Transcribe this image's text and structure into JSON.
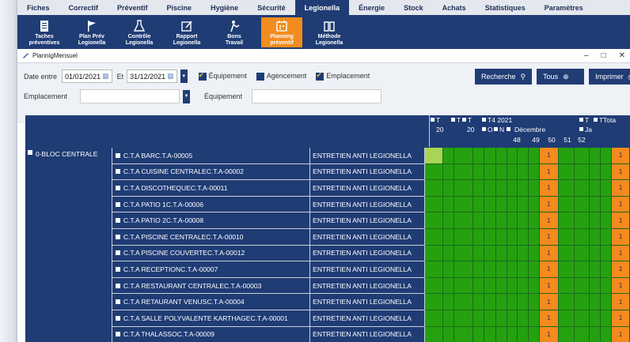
{
  "menu": [
    "Fiches",
    "Correctif",
    "Préventif",
    "Piscine",
    "Hygiène",
    "Sécurité",
    "Legionella",
    "Énergie",
    "Stock",
    "Achats",
    "Statistiques",
    "Paramètres"
  ],
  "toolbar": [
    {
      "line1": "Taches",
      "line2": "préventives",
      "icon": "clipboard-icon"
    },
    {
      "line1": "Plan Prév",
      "line2": "Legionella",
      "icon": "flag-icon"
    },
    {
      "line1": "Contrôle",
      "line2": "Legionella",
      "icon": "flask-icon"
    },
    {
      "line1": "Rapport",
      "line2": "Legionella",
      "icon": "edit-icon"
    },
    {
      "line1": "Bons",
      "line2": "Travail",
      "icon": "worker-icon"
    },
    {
      "line1": "Planning",
      "line2": "préventif",
      "icon": "calendar-icon"
    },
    {
      "line1": "Méthode",
      "line2": "Legionella",
      "icon": "book-icon"
    }
  ],
  "window": {
    "title": "PlannigMensuel",
    "minimize": "–",
    "maximize": "□",
    "close": "✕"
  },
  "filters": {
    "date_label": "Date entre",
    "date_from": "01/01/2021",
    "and_label": "Et",
    "date_to": "31/12/2021",
    "chk_equipement": "Équipement",
    "chk_agencement": "Agencement",
    "chk_emplacement": "Emplacement",
    "emplacement_label": "Emplacement",
    "equipement_label": "Équipement",
    "btn_recherche": "Recherche",
    "btn_tous": "Tous",
    "btn_imprimer": "Imprimer"
  },
  "grid_header": {
    "quarter": "T4 2021",
    "month": "Décembre",
    "weeks": [
      "48",
      "49",
      "50",
      "51",
      "52"
    ],
    "t_labels": [
      "T",
      "T",
      "T",
      "T",
      "T"
    ],
    "sub_20": [
      "20",
      "20"
    ],
    "o_label": "O",
    "n_label": "N",
    "ja_label": "Ja",
    "total_label": "Tota"
  },
  "group": "0-BLOC CENTRALE",
  "rows": [
    {
      "equipment": "C.T.A BARC.T.A-00005",
      "task": "ENTRETIEN ANTI LEGIONELLA",
      "first": "lime"
    },
    {
      "equipment": "C.T.A CUISINE CENTRALEC.T.A-00002",
      "task": "ENTRETIEN ANTI LEGIONELLA",
      "first": "green"
    },
    {
      "equipment": "C.T.A DISCOTHEQUEC.T.A-00011",
      "task": "ENTRETIEN ANTI LEGIONELLA",
      "first": "green"
    },
    {
      "equipment": "C.T.A PATIO 1C.T.A-00006",
      "task": "ENTRETIEN ANTI LEGIONELLA",
      "first": "green"
    },
    {
      "equipment": "C.T.A PATIO 2C.T.A-00008",
      "task": "ENTRETIEN ANTI LEGIONELLA",
      "first": "green"
    },
    {
      "equipment": "C.T.A PISCINE CENTRALEC.T.A-00010",
      "task": "ENTRETIEN ANTI LEGIONELLA",
      "first": "green"
    },
    {
      "equipment": "C.T.A PISCINE COUVERTEC.T.A-00012",
      "task": "ENTRETIEN ANTI LEGIONELLA",
      "first": "green"
    },
    {
      "equipment": "C.T.A RECEPTIONC.T.A-00007",
      "task": "ENTRETIEN ANTI LEGIONELLA",
      "first": "green"
    },
    {
      "equipment": "C.T.A RESTAURANT CENTRALEC.T.A-00003",
      "task": "ENTRETIEN ANTI LEGIONELLA",
      "first": "green"
    },
    {
      "equipment": "C.T.A RETAURANT VENUSC.T.A-00004",
      "task": "ENTRETIEN ANTI LEGIONELLA",
      "first": "green"
    },
    {
      "equipment": "C.T.A SALLE POLYVALENTE KARTHAGEC.T.A-00001",
      "task": "ENTRETIEN ANTI LEGIONELLA",
      "first": "green"
    },
    {
      "equipment": "C.T.A THALASSOC.T.A-00009",
      "task": "ENTRETIEN ANTI LEGIONELLA",
      "first": "green"
    }
  ],
  "cell_value": "1",
  "colors": {
    "navy": "#1f3c75",
    "orange": "#f58a1f",
    "green": "#25a10f",
    "lime": "#a9d454"
  }
}
